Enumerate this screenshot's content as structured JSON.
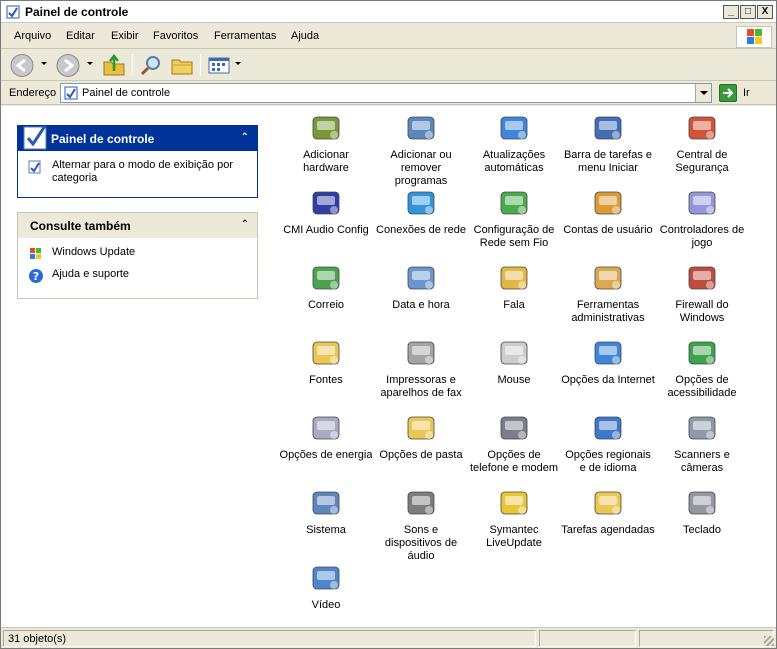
{
  "window": {
    "title": "Painel de controle",
    "buttons": {
      "minimize": "_",
      "maximize": "□",
      "close": "X"
    }
  },
  "menu": [
    "Arquivo",
    "Editar",
    "Exibir",
    "Favoritos",
    "Ferramentas",
    "Ajuda"
  ],
  "address": {
    "label": "Endereço",
    "value": "Painel de controle",
    "go_label": "Ir"
  },
  "sidebar": {
    "panel1": {
      "title": "Painel de controle",
      "collapse": "⌃",
      "link": "Alternar para o modo de exibição por categoria"
    },
    "panel2": {
      "title": "Consulte também",
      "collapse": "⌃",
      "links": [
        "Windows Update",
        "Ajuda e suporte"
      ]
    }
  },
  "items": [
    {
      "label": "Adicionar hardware",
      "icon": "hardware-icon",
      "color": "#6b8e23"
    },
    {
      "label": "Adicionar ou remover programas",
      "icon": "programs-icon",
      "color": "#4a7ab8"
    },
    {
      "label": "Atualizações automáticas",
      "icon": "windows-update-icon",
      "color": "#2a7ad8"
    },
    {
      "label": "Barra de tarefas e menu Iniciar",
      "icon": "taskbar-icon",
      "color": "#2e5fb0"
    },
    {
      "label": "Central de Segurança",
      "icon": "security-shield-icon",
      "color": "#d04020"
    },
    {
      "label": "CMI Audio Config",
      "icon": "xear-audio-icon",
      "color": "#1a2a9a"
    },
    {
      "label": "Conexões de rede",
      "icon": "network-globe-icon",
      "color": "#1a8ad8"
    },
    {
      "label": "Configuração de Rede sem Fio",
      "icon": "wireless-icon",
      "color": "#3aa03a"
    },
    {
      "label": "Contas de usuário",
      "icon": "user-accounts-icon",
      "color": "#d89020"
    },
    {
      "label": "Controladores de jogo",
      "icon": "gamepad-icon",
      "color": "#8a8ad8"
    },
    {
      "label": "Correio",
      "icon": "mail-icon",
      "color": "#3a9a3a"
    },
    {
      "label": "Data e hora",
      "icon": "clock-icon",
      "color": "#5a8ac8"
    },
    {
      "label": "Fala",
      "icon": "speech-icon",
      "color": "#e0b030"
    },
    {
      "label": "Ferramentas administrativas",
      "icon": "admin-tools-icon",
      "color": "#d8a040"
    },
    {
      "label": "Firewall do Windows",
      "icon": "firewall-icon",
      "color": "#b83a2a"
    },
    {
      "label": "Fontes",
      "icon": "fonts-folder-icon",
      "color": "#e8c040"
    },
    {
      "label": "Impressoras e aparelhos de fax",
      "icon": "printer-icon",
      "color": "#9a9a9a"
    },
    {
      "label": "Mouse",
      "icon": "mouse-icon",
      "color": "#c8c8c8"
    },
    {
      "label": "Opções da Internet",
      "icon": "internet-options-icon",
      "color": "#2a7ad8"
    },
    {
      "label": "Opções de acessibilidade",
      "icon": "accessibility-icon",
      "color": "#2a9a3a"
    },
    {
      "label": "Opções de energia",
      "icon": "power-icon",
      "color": "#a0a0c0"
    },
    {
      "label": "Opções de pasta",
      "icon": "folder-options-icon",
      "color": "#e8c040"
    },
    {
      "label": "Opções de telefone e modem",
      "icon": "phone-modem-icon",
      "color": "#707080"
    },
    {
      "label": "Opções regionais e de idioma",
      "icon": "regional-globe-icon",
      "color": "#2a6ac8"
    },
    {
      "label": "Scanners e câmeras",
      "icon": "scanner-icon",
      "color": "#8090a0"
    },
    {
      "label": "Sistema",
      "icon": "system-icon",
      "color": "#4a7ab8"
    },
    {
      "label": "Sons e dispositivos de áudio",
      "icon": "speaker-icon",
      "color": "#707070"
    },
    {
      "label": "Symantec LiveUpdate",
      "icon": "liveupdate-icon",
      "color": "#e8c020"
    },
    {
      "label": "Tarefas agendadas",
      "icon": "scheduled-tasks-icon",
      "color": "#e8c040"
    },
    {
      "label": "Teclado",
      "icon": "keyboard-icon",
      "color": "#8a8a9a"
    },
    {
      "label": "Vídeo",
      "icon": "display-icon",
      "color": "#3a7ac8"
    }
  ],
  "status": {
    "count": "31 objeto(s)"
  }
}
